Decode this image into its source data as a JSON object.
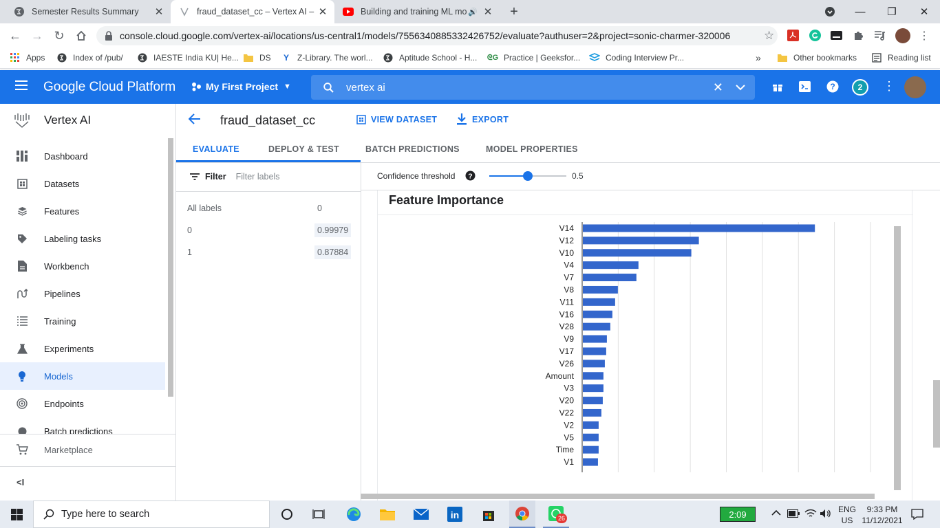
{
  "browser": {
    "tabs": [
      {
        "title": "Semester Results Summary",
        "active": false
      },
      {
        "title": "fraud_dataset_cc – Vertex AI – My",
        "active": true
      },
      {
        "title": "Building and training ML mo",
        "active": false
      }
    ],
    "url": "console.cloud.google.com/vertex-ai/locations/us-central1/models/7556340885332426752/evaluate?authuser=2&project=sonic-charmer-320006",
    "bookmarks": [
      "Apps",
      "Index of /pub/",
      "IAESTE India KU| He...",
      "DS",
      "Z-Library. The worl...",
      "Aptitude School - H...",
      "Practice | Geeksfor...",
      "Coding Interview Pr..."
    ],
    "bookmarks_overflow": "»",
    "other_bookmarks": "Other bookmarks",
    "reading_list": "Reading list"
  },
  "gcp": {
    "brand": "Google Cloud Platform",
    "project": "My First Project",
    "search_value": "vertex ai",
    "notification_count": "2"
  },
  "sidebar": {
    "title": "Vertex AI",
    "items": [
      {
        "label": "Dashboard",
        "icon": "dashboard-icon"
      },
      {
        "label": "Datasets",
        "icon": "datasets-icon"
      },
      {
        "label": "Features",
        "icon": "features-icon"
      },
      {
        "label": "Labeling tasks",
        "icon": "label-icon"
      },
      {
        "label": "Workbench",
        "icon": "workbench-icon"
      },
      {
        "label": "Pipelines",
        "icon": "pipelines-icon"
      },
      {
        "label": "Training",
        "icon": "training-icon"
      },
      {
        "label": "Experiments",
        "icon": "flask-icon"
      },
      {
        "label": "Models",
        "icon": "bulb-icon"
      },
      {
        "label": "Endpoints",
        "icon": "endpoints-icon"
      },
      {
        "label": "Batch predictions",
        "icon": "batch-icon"
      }
    ],
    "selected": "Models",
    "marketplace": "Marketplace",
    "collapse": "<I"
  },
  "main": {
    "title": "fraud_dataset_cc",
    "view_dataset": "VIEW DATASET",
    "export": "EXPORT",
    "tabs": [
      "EVALUATE",
      "DEPLOY & TEST",
      "BATCH PREDICTIONS",
      "MODEL PROPERTIES"
    ],
    "selected_tab": "EVALUATE",
    "filter_label": "Filter",
    "filter_placeholder": "Filter labels",
    "labels": [
      {
        "name": "All labels",
        "value": "0"
      },
      {
        "name": "0",
        "value": "0.99979"
      },
      {
        "name": "1",
        "value": "0.87884"
      }
    ],
    "confidence_label": "Confidence threshold",
    "confidence_value": "0.5",
    "confidence_fraction": 0.5
  },
  "chart_data": {
    "type": "bar",
    "orientation": "horizontal",
    "title": "Feature Importance",
    "categories": [
      "V14",
      "V12",
      "V10",
      "V4",
      "V7",
      "V8",
      "V11",
      "V16",
      "V28",
      "V9",
      "V17",
      "V26",
      "Amount",
      "V3",
      "V20",
      "V22",
      "V2",
      "V5",
      "Time",
      "V1"
    ],
    "values": [
      0.338,
      0.169,
      0.158,
      0.081,
      0.078,
      0.051,
      0.047,
      0.043,
      0.04,
      0.035,
      0.034,
      0.032,
      0.03,
      0.03,
      0.029,
      0.027,
      0.023,
      0.023,
      0.023,
      0.022
    ],
    "xlim": [
      0,
      0.42
    ],
    "grid": true,
    "color": "#3366cc"
  },
  "taskbar": {
    "search_placeholder": "Type here to search",
    "battery_time": "2:09",
    "lang_top": "ENG",
    "lang_bottom": "US",
    "time": "9:33 PM",
    "date": "11/12/2021",
    "whatsapp_badge": "26"
  }
}
